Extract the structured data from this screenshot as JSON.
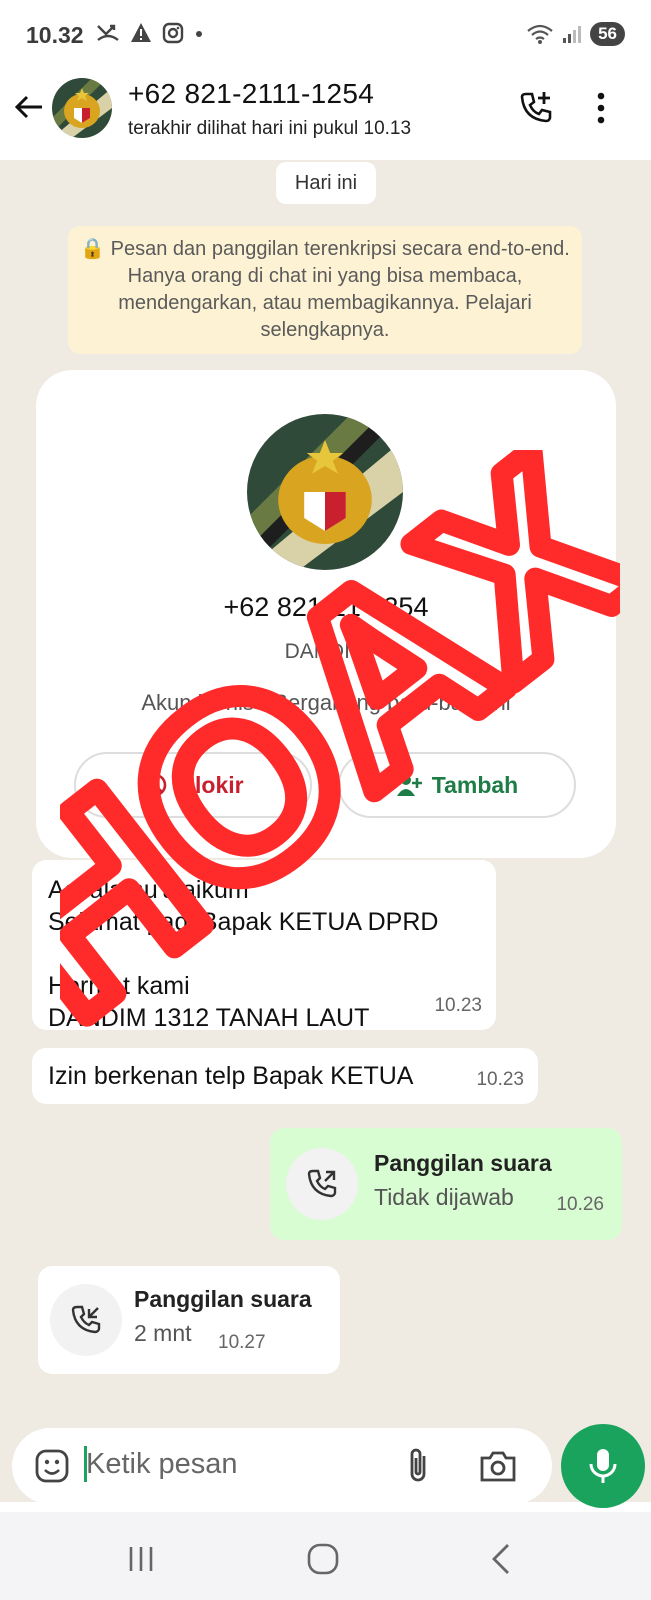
{
  "status_bar": {
    "time": "10.32",
    "battery": "56"
  },
  "header": {
    "contact_name": "+62 821-2111-1254",
    "last_seen": "terakhir dilihat hari ini pukul 10.13"
  },
  "chat": {
    "date_label": "Hari ini",
    "encryption_notice": "🔒 Pesan dan panggilan terenkripsi secara end-to-end. Hanya orang di chat ini yang bisa membaca, mendengarkan, atau membagikannya. Pelajari selengkapnya.",
    "contact_card": {
      "number": "+62 821-21   1254",
      "label": "DANDIM",
      "business_text": "Akun bisnis · Bergabung baru-baru ini",
      "block_label": "Blokir",
      "add_label": "Tambah"
    },
    "messages": [
      {
        "line1": "Assalamu'alaikum",
        "line2": "Selamat pagi Bapak KETUA DPRD",
        "line3": "Hormat kami",
        "line4": "DANDIM 1312 TANAH LAUT",
        "time": "10.23"
      },
      {
        "text": "Izin berkenan telp Bapak KETUA",
        "time": "10.23"
      }
    ],
    "outgoing_call": {
      "title": "Panggilan suara",
      "status": "Tidak dijawab",
      "time": "10.26"
    },
    "incoming_call": {
      "title": "Panggilan suara",
      "duration": "2 mnt",
      "time": "10.27"
    },
    "overlay_text": "HOAX"
  },
  "composer": {
    "placeholder": "Ketik pesan"
  },
  "colors": {
    "accent": "#1aa35c",
    "outgoing_bubble": "#d9fdd3",
    "chat_bg": "#efeae2",
    "hoax_red": "#ff2b2b"
  }
}
